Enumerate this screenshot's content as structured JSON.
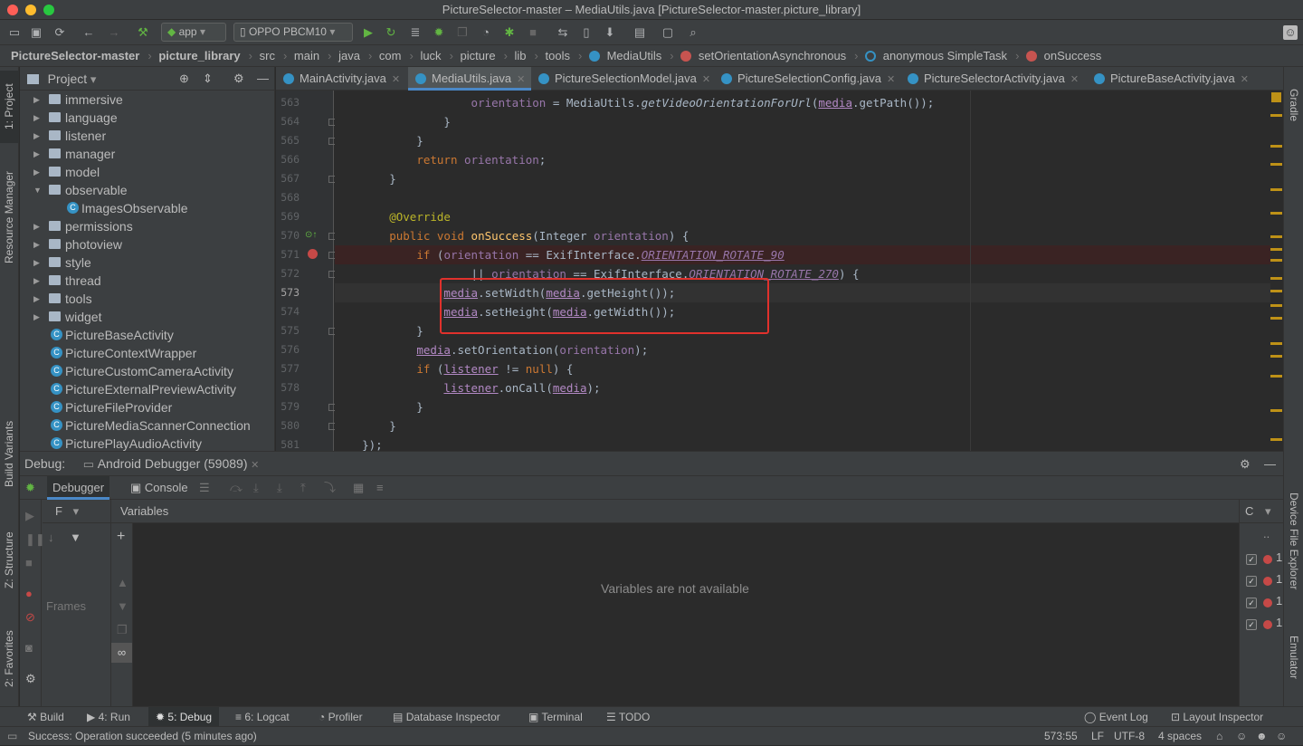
{
  "window": {
    "title": "PictureSelector-master – MediaUtils.java [PictureSelector-master.picture_library]"
  },
  "toolbar": {
    "run_config": "app",
    "device": "OPPO PBCM10"
  },
  "breadcrumb": [
    "PictureSelector-master",
    "picture_library",
    "src",
    "main",
    "java",
    "com",
    "luck",
    "picture",
    "lib",
    "tools",
    "MediaUtils",
    "setOrientationAsynchronous",
    "anonymous SimpleTask",
    "onSuccess"
  ],
  "left_strip": {
    "project": "1: Project",
    "resource_manager": "Resource Manager",
    "build_variants": "Build Variants",
    "structure": "Z: Structure",
    "favorites": "2: Favorites"
  },
  "right_strip": {
    "gradle": "Gradle",
    "device_file_explorer": "Device File Explorer",
    "emulator": "Emulator"
  },
  "project": {
    "title": "Project",
    "tree": [
      {
        "label": "immersive",
        "kind": "folder"
      },
      {
        "label": "language",
        "kind": "folder"
      },
      {
        "label": "listener",
        "kind": "folder"
      },
      {
        "label": "manager",
        "kind": "folder"
      },
      {
        "label": "model",
        "kind": "folder"
      },
      {
        "label": "observable",
        "kind": "folder-open"
      },
      {
        "label": "ImagesObservable",
        "kind": "class-child"
      },
      {
        "label": "permissions",
        "kind": "folder"
      },
      {
        "label": "photoview",
        "kind": "folder"
      },
      {
        "label": "style",
        "kind": "folder"
      },
      {
        "label": "thread",
        "kind": "folder"
      },
      {
        "label": "tools",
        "kind": "folder"
      },
      {
        "label": "widget",
        "kind": "folder"
      },
      {
        "label": "PictureBaseActivity",
        "kind": "class"
      },
      {
        "label": "PictureContextWrapper",
        "kind": "class"
      },
      {
        "label": "PictureCustomCameraActivity",
        "kind": "class"
      },
      {
        "label": "PictureExternalPreviewActivity",
        "kind": "class"
      },
      {
        "label": "PictureFileProvider",
        "kind": "class"
      },
      {
        "label": "PictureMediaScannerConnection",
        "kind": "class"
      },
      {
        "label": "PicturePlayAudioActivity",
        "kind": "class"
      }
    ]
  },
  "tabs": [
    {
      "label": "MainActivity.java"
    },
    {
      "label": "MediaUtils.java",
      "active": true
    },
    {
      "label": "PictureSelectionModel.java"
    },
    {
      "label": "PictureSelectionConfig.java"
    },
    {
      "label": "PictureSelectorActivity.java"
    },
    {
      "label": "PictureBaseActivity.java"
    }
  ],
  "line_numbers": [
    "563",
    "564",
    "565",
    "566",
    "567",
    "568",
    "569",
    "570",
    "571",
    "572",
    "573",
    "574",
    "575",
    "576",
    "577",
    "578",
    "579",
    "580",
    "581"
  ],
  "debug": {
    "label": "Debug:",
    "session": "Android Debugger (59089)",
    "tab_debugger": "Debugger",
    "tab_console": "Console",
    "frames_label": "Frames",
    "frames_filter": "F",
    "variables_title": "Variables",
    "variables_empty": "Variables are not available",
    "bp_col": "..",
    "bp_values": [
      "1",
      "1",
      "1",
      "1"
    ],
    "right_c": "C"
  },
  "bottom_tabs": {
    "build": "Build",
    "run": "4: Run",
    "debug": "5: Debug",
    "logcat": "6: Logcat",
    "profiler": "Profiler",
    "db_inspector": "Database Inspector",
    "terminal": "Terminal",
    "todo": "TODO",
    "event_log": "Event Log",
    "layout_inspector": "Layout Inspector"
  },
  "status": {
    "message": "Success: Operation succeeded (5 minutes ago)",
    "position": "573:55",
    "line_sep": "LF",
    "encoding": "UTF-8",
    "indent": "4 spaces"
  },
  "colors": {
    "keyword": "#cc7832",
    "field": "#9876aa",
    "method": "#ffc66d",
    "annotation": "#bbb529",
    "highlight_box": "#e0312c",
    "active_tab": "#4a88c7"
  }
}
